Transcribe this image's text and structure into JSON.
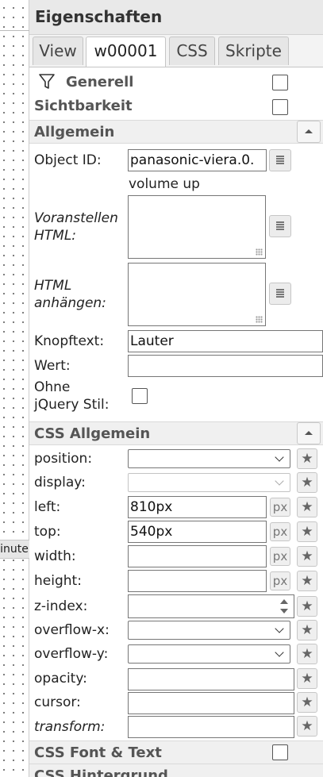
{
  "canvas": {
    "widget_label": "Minuten"
  },
  "panel": {
    "title": "Eigenschaften"
  },
  "tabs": [
    {
      "label": "View"
    },
    {
      "label": "w00001"
    },
    {
      "label": "CSS"
    },
    {
      "label": "Skripte"
    }
  ],
  "filter": {
    "generell_label": "Generell",
    "sichtbarkeit_label": "Sichtbarkeit"
  },
  "allgemein": {
    "title": "Allgemein",
    "object_id_label": "Object ID:",
    "object_id_value": "panasonic-viera.0.",
    "object_id_hint": "volume up",
    "prepend_html_label_1": "Voranstellen",
    "prepend_html_label_2": "HTML:",
    "append_html_label_1": "HTML",
    "append_html_label_2": "anhängen:",
    "button_text_label": "Knopftext:",
    "button_text_value": "Lauter",
    "value_label": "Wert:",
    "value_value": "",
    "no_jquery_label_1": "Ohne",
    "no_jquery_label_2": "jQuery Stil:"
  },
  "css_general": {
    "title": "CSS Allgemein",
    "position_label": "position:",
    "display_label": "display:",
    "left_label": "left:",
    "left_value": "810px",
    "top_label": "top:",
    "top_value": "540px",
    "width_label": "width:",
    "height_label": "height:",
    "zindex_label": "z-index:",
    "overflow_x_label": "overflow-x:",
    "overflow_y_label": "overflow-y:",
    "opacity_label": "opacity:",
    "cursor_label": "cursor:",
    "transform_label": "transform:",
    "unit_px": "px",
    "star_glyph": "★"
  },
  "css_font": {
    "title": "CSS Font & Text"
  },
  "css_background": {
    "title": "CSS Hintergrund"
  }
}
